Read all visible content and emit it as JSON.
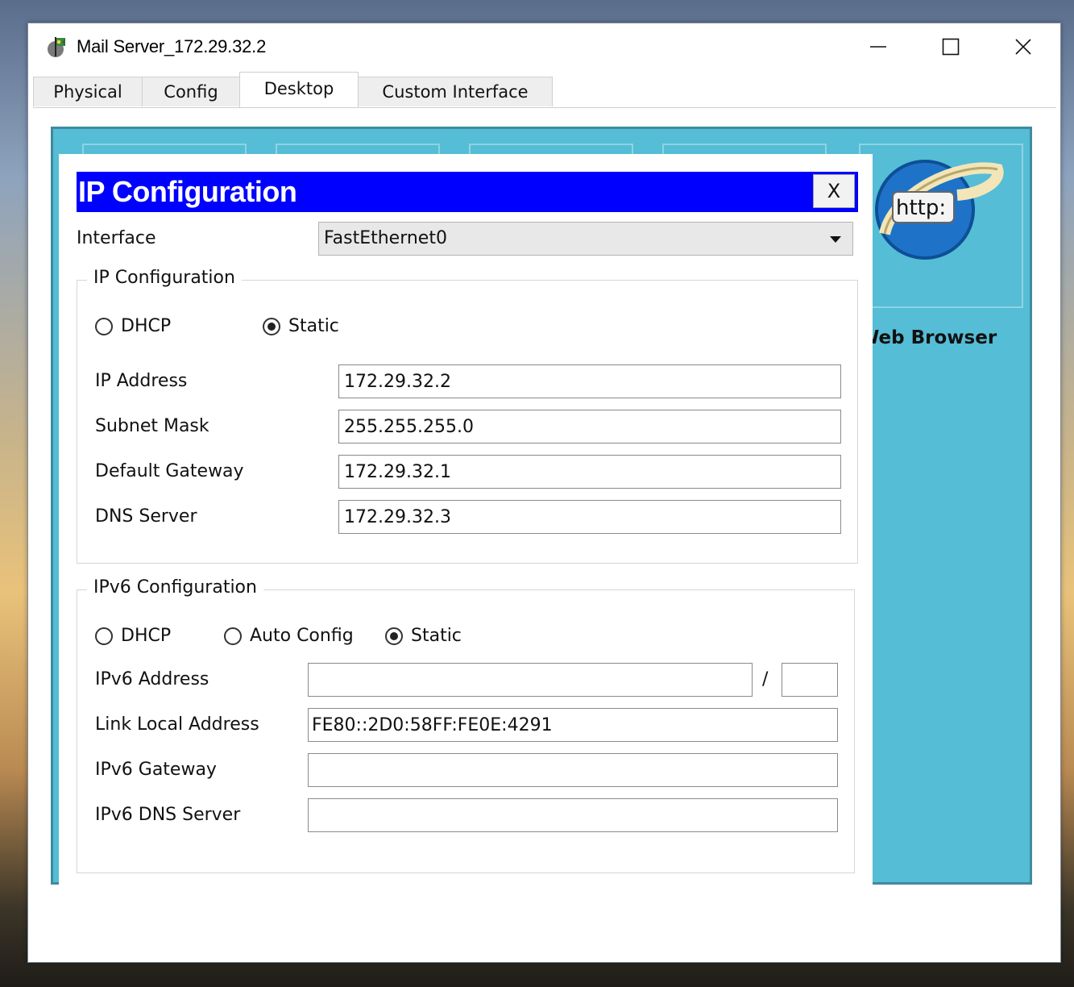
{
  "window": {
    "title": "Mail Server_172.29.32.2"
  },
  "tabs": [
    {
      "label": "Physical"
    },
    {
      "label": "Config"
    },
    {
      "label": "Desktop",
      "active": true
    },
    {
      "label": "Custom Interface"
    }
  ],
  "desktop": {
    "web_browser_label": "Web Browser",
    "web_browser_icon_text": "http:"
  },
  "dialog": {
    "title": "IP Configuration",
    "close_label": "X",
    "interface_label": "Interface",
    "interface_value": "FastEthernet0",
    "ipv4": {
      "legend": "IP Configuration",
      "dhcp_label": "DHCP",
      "static_label": "Static",
      "mode": "Static",
      "ip_address_label": "IP Address",
      "ip_address": "172.29.32.2",
      "subnet_mask_label": "Subnet Mask",
      "subnet_mask": "255.255.255.0",
      "gateway_label": "Default Gateway",
      "gateway": "172.29.32.1",
      "dns_label": "DNS Server",
      "dns": "172.29.32.3"
    },
    "ipv6": {
      "legend": "IPv6 Configuration",
      "dhcp_label": "DHCP",
      "auto_label": "Auto Config",
      "static_label": "Static",
      "mode": "Static",
      "address_label": "IPv6 Address",
      "address": "",
      "prefix_separator": "/",
      "prefix": "",
      "link_local_label": "Link Local Address",
      "link_local": "FE80::2D0:58FF:FE0E:4291",
      "gateway_label": "IPv6 Gateway",
      "gateway": "",
      "dns_label": "IPv6 DNS Server",
      "dns": ""
    }
  },
  "colors": {
    "dialog_header": "#0000ff",
    "desktop_panel": "#55bdd6"
  }
}
